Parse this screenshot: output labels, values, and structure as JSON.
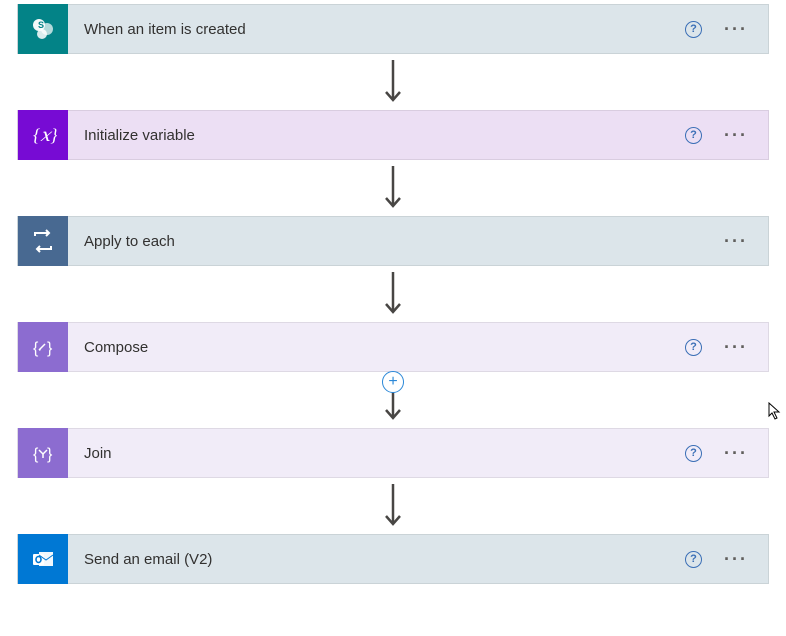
{
  "flow": {
    "steps": [
      {
        "id": "sharepoint-trigger",
        "label": "When an item is created",
        "hasHelp": true
      },
      {
        "id": "initialize-variable",
        "label": "Initialize variable",
        "hasHelp": true
      },
      {
        "id": "apply-to-each",
        "label": "Apply to each",
        "hasHelp": false
      },
      {
        "id": "compose",
        "label": "Compose",
        "hasHelp": true
      },
      {
        "id": "join",
        "label": "Join",
        "hasHelp": true
      },
      {
        "id": "send-email",
        "label": "Send an email (V2)",
        "hasHelp": true
      }
    ],
    "addButtonAfterIndex": 3
  },
  "icons": {
    "help": "?",
    "more": "···",
    "add": "+"
  }
}
